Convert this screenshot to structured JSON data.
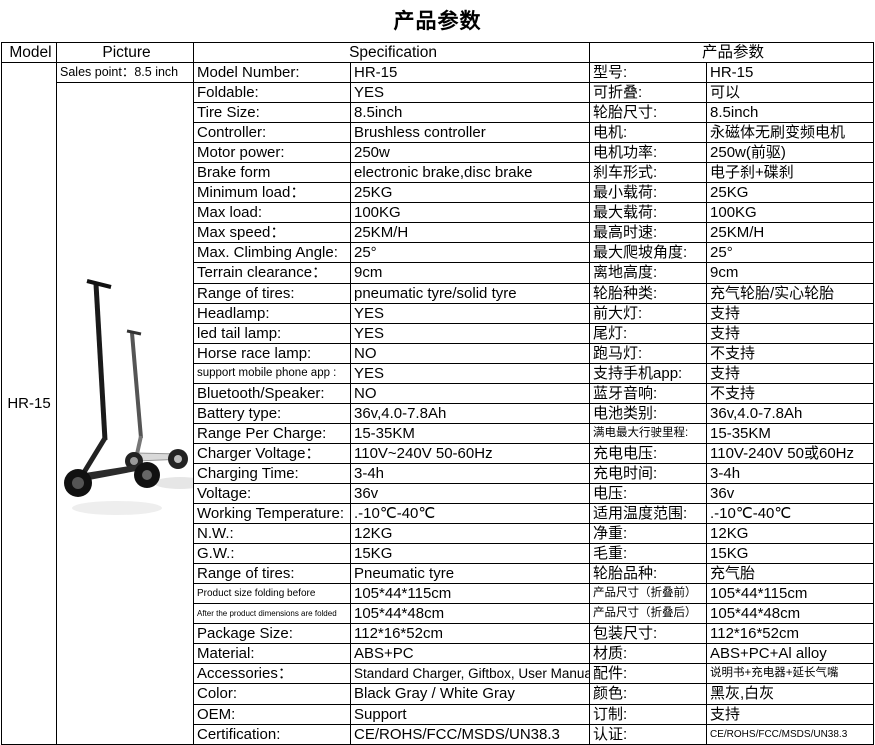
{
  "title": "产品参数",
  "header": {
    "model": "Model",
    "picture": "Picture",
    "specification": "Specification",
    "specification_cn": "产品参数"
  },
  "model_name": "HR-15",
  "sales_point": "Sales point：8.5 inch",
  "rows": [
    {
      "en_label": "Model Number:",
      "en_value": "HR-15",
      "cn_label": "型号:",
      "cn_value": "HR-15"
    },
    {
      "en_label": "Foldable:",
      "en_value": "YES",
      "cn_label": "可折叠:",
      "cn_value": "可以"
    },
    {
      "en_label": "Tire Size:",
      "en_value": "8.5inch",
      "cn_label": "轮胎尺寸:",
      "cn_value": "8.5inch"
    },
    {
      "en_label": "Controller:",
      "en_value": "Brushless controller",
      "cn_label": "电机:",
      "cn_value": "永磁体无刷变频电机"
    },
    {
      "en_label": "Motor power:",
      "en_value": "250w",
      "cn_label": "电机功率:",
      "cn_value": "250w(前驱)"
    },
    {
      "en_label": "Brake form",
      "en_value": "electronic brake,disc brake",
      "cn_label": "刹车形式:",
      "cn_value": "电子刹+碟刹"
    },
    {
      "en_label": "Minimum load：",
      "en_value": "25KG",
      "cn_label": "最小载荷:",
      "cn_value": "25KG"
    },
    {
      "en_label": "Max load:",
      "en_value": "100KG",
      "cn_label": "最大载荷:",
      "cn_value": "100KG"
    },
    {
      "en_label": "Max speed：",
      "en_value": "25KM/H",
      "cn_label": "最高时速:",
      "cn_value": "25KM/H"
    },
    {
      "en_label": "Max. Climbing Angle:",
      "en_value": "25°",
      "cn_label": "最大爬坡角度:",
      "cn_value": "25°"
    },
    {
      "en_label": "Terrain clearance：",
      "en_value": "9cm",
      "cn_label": "离地高度:",
      "cn_value": "9cm"
    },
    {
      "en_label": "Range of tires:",
      "en_value": "pneumatic tyre/solid tyre",
      "cn_label": "轮胎种类:",
      "cn_value": "充气轮胎/实心轮胎"
    },
    {
      "en_label": "Headlamp:",
      "en_value": "YES",
      "cn_label": "前大灯:",
      "cn_value": "支持"
    },
    {
      "en_label": "led tail lamp:",
      "en_value": "YES",
      "cn_label": "尾灯:",
      "cn_value": "支持"
    },
    {
      "en_label": "Horse race lamp:",
      "en_value": "NO",
      "cn_label": "跑马灯:",
      "cn_value": "不支持"
    },
    {
      "en_label": "support mobile phone app :",
      "en_value": "YES",
      "cn_label": "支持手机app:",
      "cn_value": "支持"
    },
    {
      "en_label": "Bluetooth/Speaker:",
      "en_value": "NO",
      "cn_label": "蓝牙音响:",
      "cn_value": "不支持"
    },
    {
      "en_label": "Battery type:",
      "en_value": "36v,4.0-7.8Ah",
      "cn_label": "电池类别:",
      "cn_value": "36v,4.0-7.8Ah"
    },
    {
      "en_label": "Range Per Charge:",
      "en_value": "15-35KM",
      "cn_label": "满电最大行驶里程:",
      "cn_value": "15-35KM"
    },
    {
      "en_label": "Charger Voltage：",
      "en_value": "110V~240V 50-60Hz",
      "cn_label": "充电电压:",
      "cn_value": "110V-240V 50或60Hz"
    },
    {
      "en_label": "Charging Time:",
      "en_value": "3-4h",
      "cn_label": "充电时间:",
      "cn_value": "3-4h"
    },
    {
      "en_label": "Voltage:",
      "en_value": "36v",
      "cn_label": "电压:",
      "cn_value": "36v"
    },
    {
      "en_label": "Working Temperature:",
      "en_value": ".-10℃-40℃",
      "cn_label": "适用温度范围:",
      "cn_value": ".-10℃-40℃"
    },
    {
      "en_label": "N.W.:",
      "en_value": "12KG",
      "cn_label": "净重:",
      "cn_value": "12KG"
    },
    {
      "en_label": "G.W.:",
      "en_value": "15KG",
      "cn_label": "毛重:",
      "cn_value": "15KG"
    },
    {
      "en_label": "Range of tires:",
      "en_value": "Pneumatic tyre",
      "cn_label": "轮胎品种:",
      "cn_value": "充气胎"
    },
    {
      "en_label": "Product size folding before",
      "en_value": "105*44*115cm",
      "cn_label": "产品尺寸（折叠前）",
      "cn_value": "105*44*115cm"
    },
    {
      "en_label": "After the product dimensions are folded",
      "en_value": "105*44*48cm",
      "cn_label": "产品尺寸（折叠后）",
      "cn_value": "105*44*48cm"
    },
    {
      "en_label": "Package Size:",
      "en_value": "112*16*52cm",
      "cn_label": "包装尺寸:",
      "cn_value": "112*16*52cm"
    },
    {
      "en_label": "Material:",
      "en_value": "ABS+PC",
      "cn_label": "材质:",
      "cn_value": "ABS+PC+Al alloy"
    },
    {
      "en_label": "Accessories：",
      "en_value": "Standard Charger, Giftbox, User Manual",
      "cn_label": "配件:",
      "cn_value": "说明书+充电器+延长气嘴"
    },
    {
      "en_label": "Color:",
      "en_value": "Black Gray / White Gray",
      "cn_label": "颜色:",
      "cn_value": "黑灰,白灰"
    },
    {
      "en_label": "OEM:",
      "en_value": "Support",
      "cn_label": "订制:",
      "cn_value": "支持"
    },
    {
      "en_label": "Certification:",
      "en_value": "CE/ROHS/FCC/MSDS/UN38.3",
      "cn_label": "认证:",
      "cn_value": "CE/ROHS/FCC/MSDS/UN38.3"
    }
  ]
}
